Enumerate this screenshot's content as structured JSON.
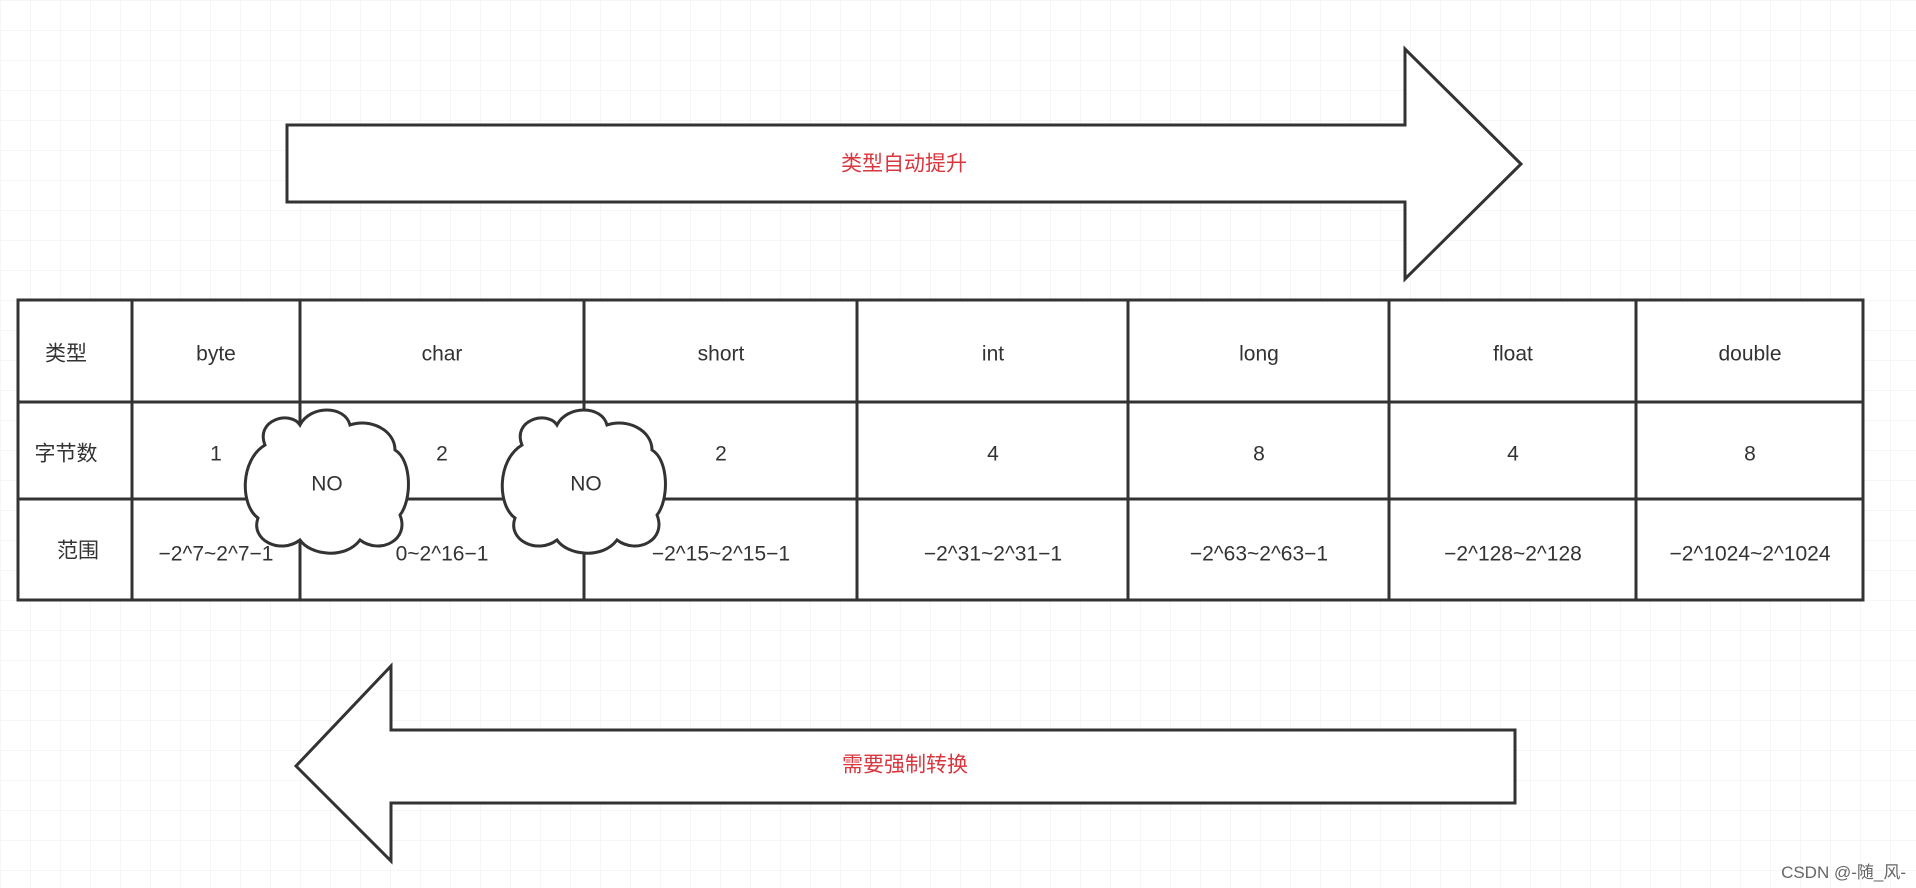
{
  "diagram": {
    "top_arrow": {
      "label": "类型自动提升",
      "direction": "right"
    },
    "bottom_arrow": {
      "label": "需要强制转换",
      "direction": "left"
    },
    "table": {
      "row_headers": [
        "类型",
        "字节数",
        "范围"
      ],
      "columns": [
        {
          "type": "byte",
          "bytes": "1",
          "range": "−2^7~2^7−1"
        },
        {
          "type": "char",
          "bytes": "2",
          "range": "0~2^16−1"
        },
        {
          "type": "short",
          "bytes": "2",
          "range": "−2^15~2^15−1"
        },
        {
          "type": "int",
          "bytes": "4",
          "range": "−2^31~2^31−1"
        },
        {
          "type": "long",
          "bytes": "8",
          "range": "−2^63~2^63−1"
        },
        {
          "type": "float",
          "bytes": "4",
          "range": "−2^128~2^128"
        },
        {
          "type": "double",
          "bytes": "8",
          "range": "−2^1024~2^1024"
        }
      ]
    },
    "clouds": [
      {
        "label": "NO"
      },
      {
        "label": "NO"
      }
    ],
    "label_color": "#d9363e"
  },
  "watermark": "CSDN @-随_风-"
}
